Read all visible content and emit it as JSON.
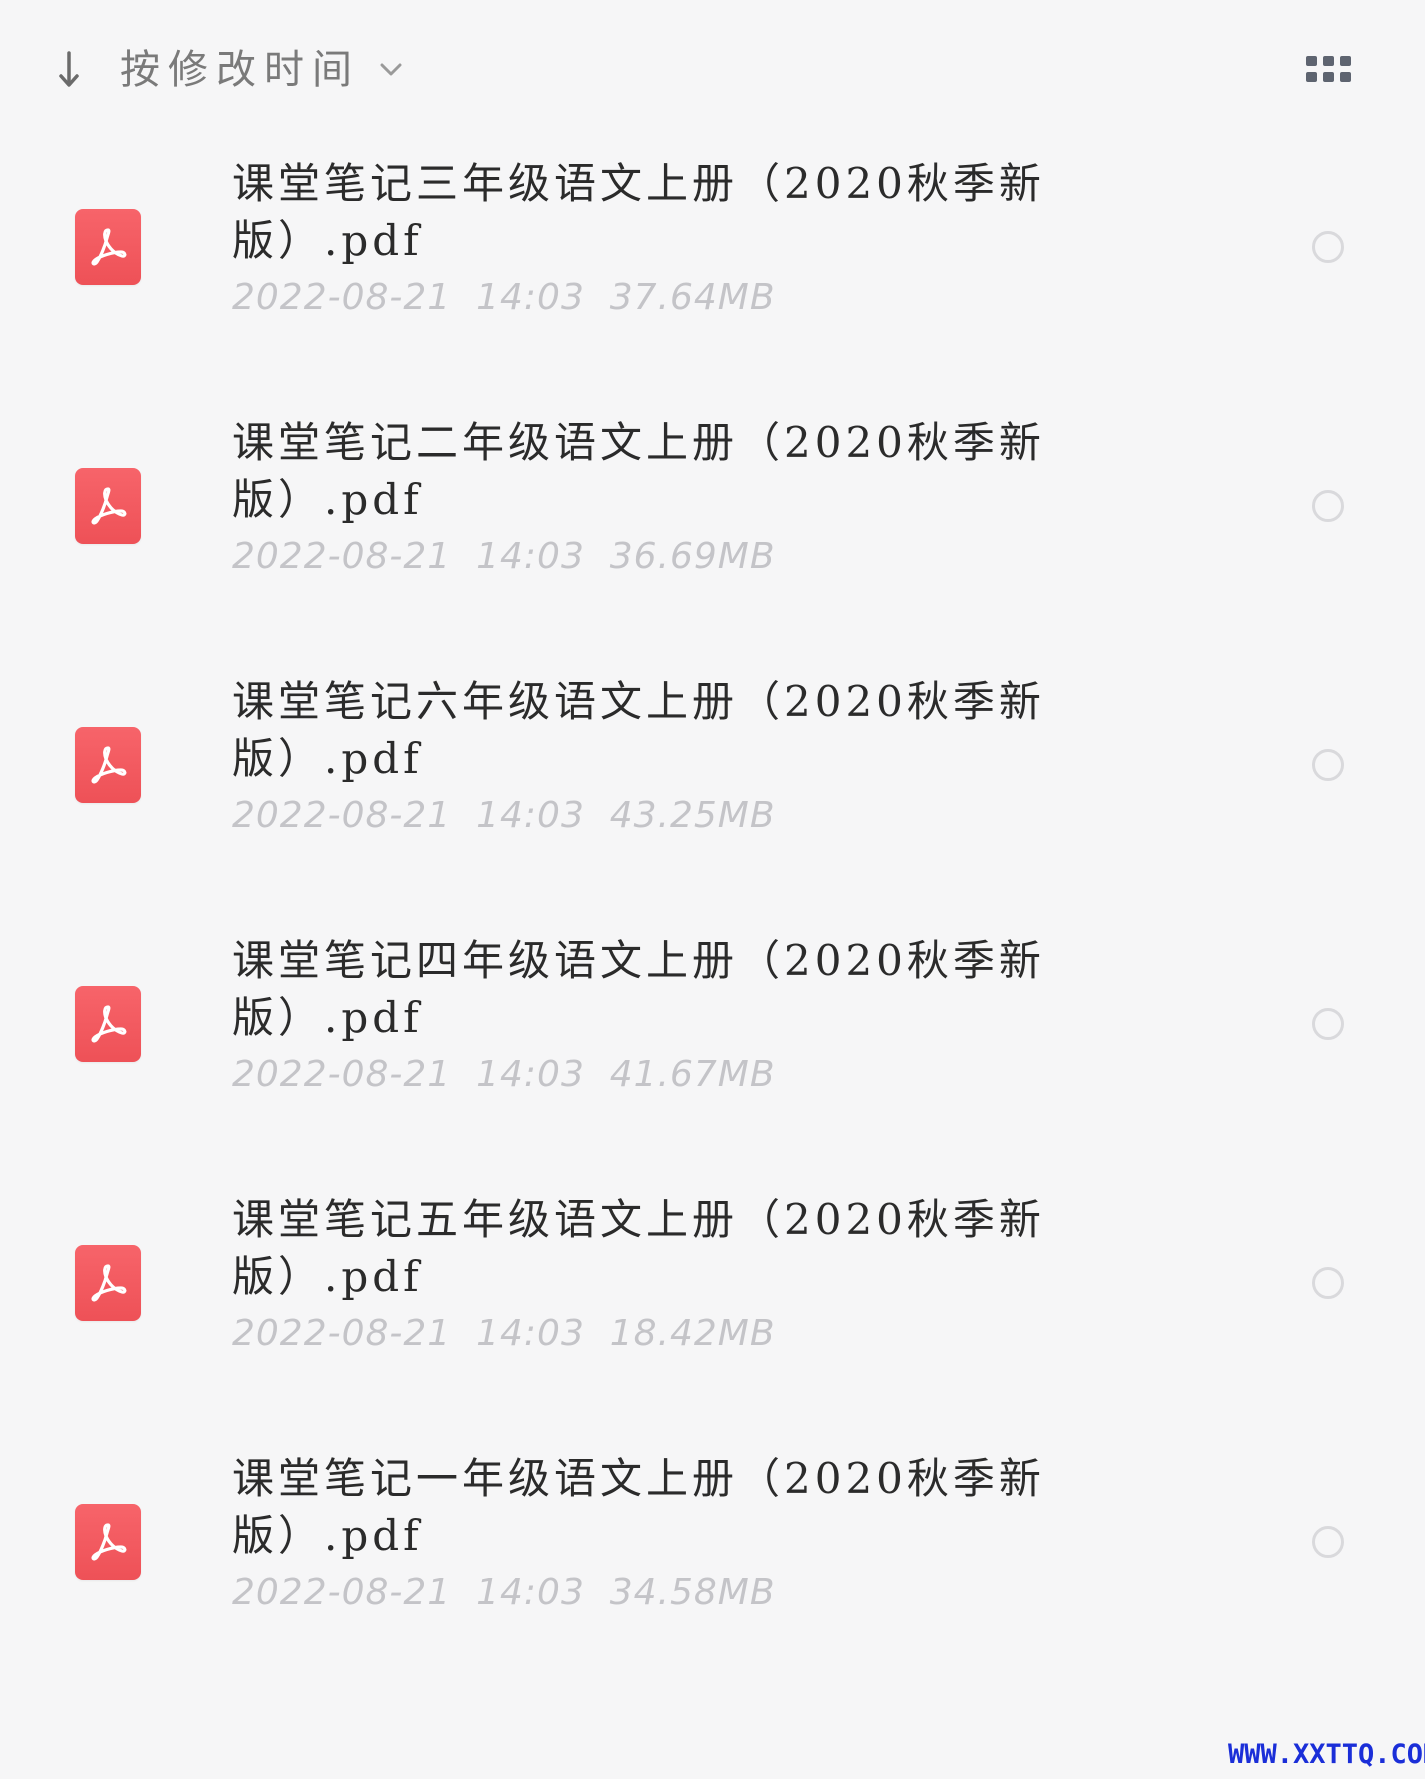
{
  "toolbar": {
    "sort_label": "按修改时间",
    "sort_direction_icon": "arrow-down-icon",
    "sort_dropdown_icon": "chevron-down-icon",
    "view_toggle_icon": "grid-view-icon"
  },
  "files": [
    {
      "name": "课堂笔记三年级语文上册（2020秋季新版）.pdf",
      "date": "2022-08-21",
      "time": "14:03",
      "size": "37.64MB",
      "icon": "pdf-icon"
    },
    {
      "name": "课堂笔记二年级语文上册（2020秋季新版）.pdf",
      "date": "2022-08-21",
      "time": "14:03",
      "size": "36.69MB",
      "icon": "pdf-icon"
    },
    {
      "name": "课堂笔记六年级语文上册（2020秋季新版）.pdf",
      "date": "2022-08-21",
      "time": "14:03",
      "size": "43.25MB",
      "icon": "pdf-icon"
    },
    {
      "name": "课堂笔记四年级语文上册（2020秋季新版）.pdf",
      "date": "2022-08-21",
      "time": "14:03",
      "size": "41.67MB",
      "icon": "pdf-icon"
    },
    {
      "name": "课堂笔记五年级语文上册（2020秋季新版）.pdf",
      "date": "2022-08-21",
      "time": "14:03",
      "size": "18.42MB",
      "icon": "pdf-icon"
    },
    {
      "name": "课堂笔记一年级语文上册（2020秋季新版）.pdf",
      "date": "2022-08-21",
      "time": "14:03",
      "size": "34.58MB",
      "icon": "pdf-icon"
    }
  ],
  "watermark": "WWW.XXTTQ.COM",
  "colors": {
    "background": "#f6f6f7",
    "pdf_icon": "#f15a5f",
    "meta_text": "#c4c4c8",
    "select_circle": "#d9d9dc",
    "watermark": "#1a2ed8"
  }
}
